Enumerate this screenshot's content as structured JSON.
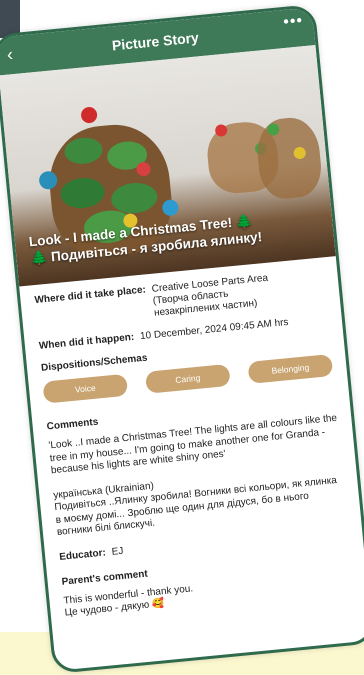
{
  "header": {
    "title": "Picture Story",
    "back_icon": "chevron-left-icon",
    "more_icon": "ellipsis-icon"
  },
  "hero": {
    "caption_line1": "Look - I made a Christmas Tree! 🌲",
    "caption_line2": "🌲 Подивіться - я зробила ялинку!"
  },
  "details": {
    "place_label": "Where did it take place:",
    "place_value_1": "Creative Loose Parts Area",
    "place_value_2": "(Творча область",
    "place_value_3": "незакріплених частин)",
    "when_label": "When did it happen:",
    "when_value": "10 December, 2024 09:45 AM hrs"
  },
  "dispositions": {
    "title": "Dispositions/Schemas",
    "chips": [
      "Voice",
      "Caring",
      "Belonging"
    ]
  },
  "comments": {
    "title": "Comments",
    "english": "'Look ..I made a Christmas Tree! The lights are all colours like the tree in my house... I'm going to make another one for Granda - because his lights are white shiny ones'",
    "ukr_label": "українська (Ukrainian)",
    "ukrainian": "Подивіться ..Ялинку зробила! Вогники всі кольори, як ялинка в моєму домі... Зроблю ще один для дідуся, бо в нього вогники білі блискучі."
  },
  "educator": {
    "label": "Educator:",
    "value": "EJ"
  },
  "parent": {
    "title": "Parent's comment",
    "line1": "This is wonderful - thank you.",
    "line2": "Це чудово - дякую 🥰"
  },
  "colors": {
    "header_green": "#3e7a57",
    "chip_tan": "#c9a470",
    "bezel": "#2f6a4d",
    "bg_yellow": "#fbf7cf"
  }
}
